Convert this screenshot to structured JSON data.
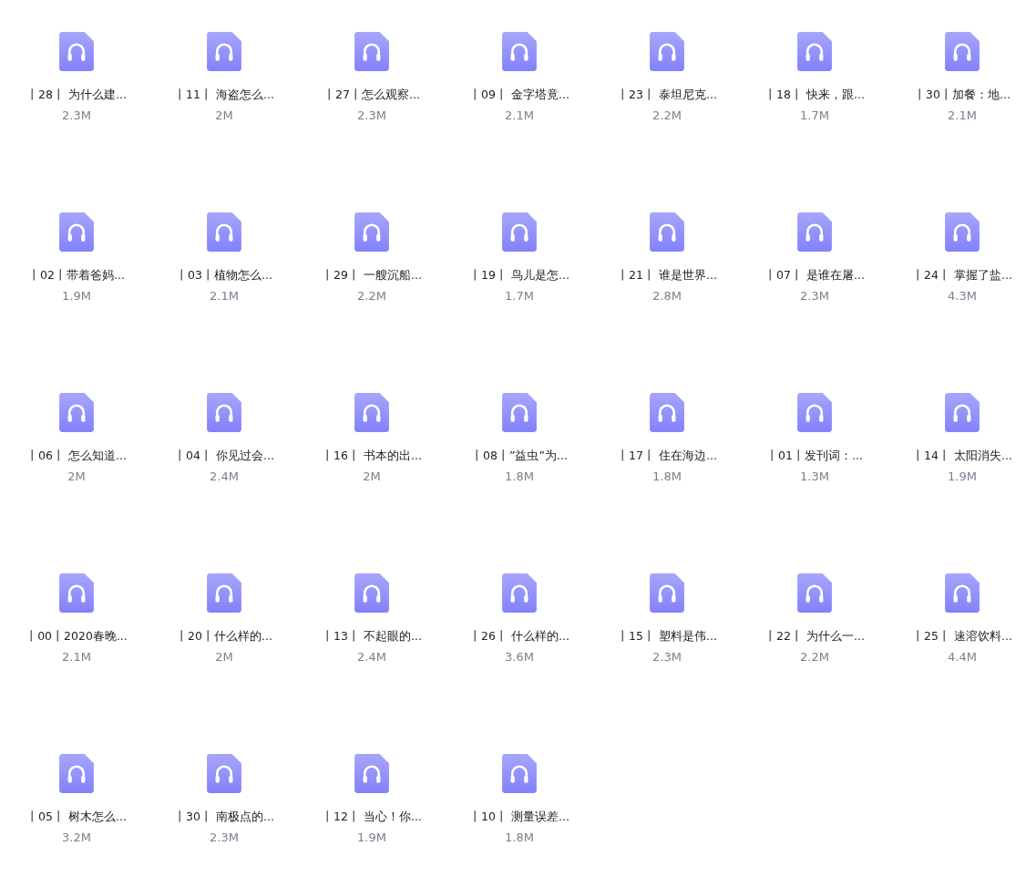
{
  "files": [
    {
      "name": "丨28丨 为什么建...",
      "size": "2.3M"
    },
    {
      "name": "丨11丨 海盗怎么...",
      "size": "2M"
    },
    {
      "name": "丨27丨怎么观察...",
      "size": "2.3M"
    },
    {
      "name": "丨09丨 金字塔竟...",
      "size": "2.1M"
    },
    {
      "name": "丨23丨 泰坦尼克...",
      "size": "2.2M"
    },
    {
      "name": "丨18丨 快来，跟...",
      "size": "1.7M"
    },
    {
      "name": "丨30丨加餐：地...",
      "size": "2.1M"
    },
    {
      "name": "丨02丨带着爸妈...",
      "size": "1.9M"
    },
    {
      "name": "丨03丨植物怎么...",
      "size": "2.1M"
    },
    {
      "name": "丨29丨 一艘沉船...",
      "size": "2.2M"
    },
    {
      "name": "丨19丨 鸟儿是怎...",
      "size": "1.7M"
    },
    {
      "name": "丨21丨 谁是世界...",
      "size": "2.8M"
    },
    {
      "name": "丨07丨 是谁在屠...",
      "size": "2.3M"
    },
    {
      "name": "丨24丨 掌握了盐...",
      "size": "4.3M"
    },
    {
      "name": "丨06丨 怎么知道...",
      "size": "2M"
    },
    {
      "name": "丨04丨 你见过会...",
      "size": "2.4M"
    },
    {
      "name": "丨16丨 书本的出...",
      "size": "2M"
    },
    {
      "name": "丨08丨”益虫”为...",
      "size": "1.8M"
    },
    {
      "name": "丨17丨 住在海边...",
      "size": "1.8M"
    },
    {
      "name": "丨01丨发刊词：...",
      "size": "1.3M"
    },
    {
      "name": "丨14丨 太阳消失...",
      "size": "1.9M"
    },
    {
      "name": "丨00丨2020春晚...",
      "size": "2.1M"
    },
    {
      "name": "丨20丨什么样的...",
      "size": "2M"
    },
    {
      "name": "丨13丨 不起眼的...",
      "size": "2.4M"
    },
    {
      "name": "丨26丨 什么样的...",
      "size": "3.6M"
    },
    {
      "name": "丨15丨 塑料是伟...",
      "size": "2.3M"
    },
    {
      "name": "丨22丨 为什么一...",
      "size": "2.2M"
    },
    {
      "name": "丨25丨 速溶饮料...",
      "size": "4.4M"
    },
    {
      "name": "丨05丨 树木怎么...",
      "size": "3.2M"
    },
    {
      "name": "丨30丨 南极点的...",
      "size": "2.3M"
    },
    {
      "name": "丨12丨 当心！你...",
      "size": "1.9M"
    },
    {
      "name": "丨10丨 测量误差...",
      "size": "1.8M"
    }
  ]
}
